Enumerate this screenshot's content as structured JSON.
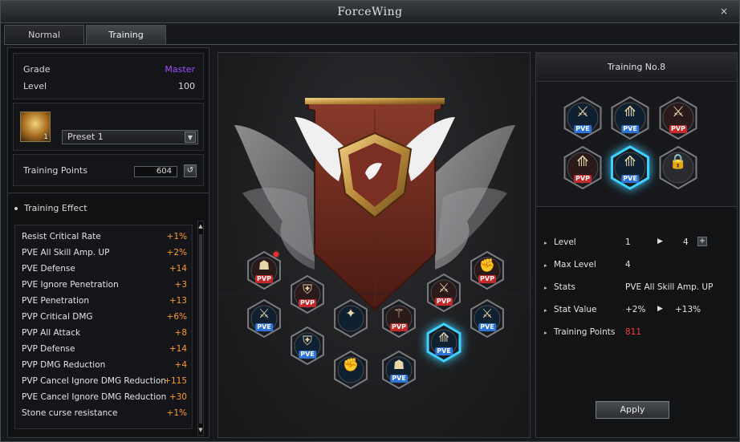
{
  "window": {
    "title": "ForceWing",
    "close_label": "×"
  },
  "tabs": [
    {
      "label": "Normal"
    },
    {
      "label": "Training"
    }
  ],
  "left": {
    "grade": {
      "label": "Grade",
      "value": "Master"
    },
    "level": {
      "label": "Level",
      "value": "100"
    },
    "portrait_num": "1",
    "preset": {
      "selected": "Preset 1"
    },
    "training_points": {
      "label": "Training Points",
      "value": "604"
    },
    "effect_header": "Training Effect",
    "effects": [
      {
        "name": "Resist Critical Rate",
        "value": "+1%"
      },
      {
        "name": "PVE All Skill Amp. UP",
        "value": "+2%"
      },
      {
        "name": "PVE Defense",
        "value": "+14"
      },
      {
        "name": "PVE Ignore Penetration",
        "value": "+3"
      },
      {
        "name": "PVE Penetration",
        "value": "+13"
      },
      {
        "name": "PVP Critical DMG",
        "value": "+6%"
      },
      {
        "name": "PVP All Attack",
        "value": "+8"
      },
      {
        "name": "PVP Defense",
        "value": "+14"
      },
      {
        "name": "PVP DMG Reduction",
        "value": "+4"
      },
      {
        "name": "PVP Cancel Ignore DMG Reduction",
        "value": "+115"
      },
      {
        "name": "PVE Cancel Ignore DMG Reduction",
        "value": "+30"
      },
      {
        "name": "Stone curse resistance",
        "value": "+1%"
      }
    ]
  },
  "tree_nodes": [
    {
      "badge": "PVP",
      "icon": "mage-icon",
      "red_dot": true
    },
    {
      "badge": "PVP",
      "icon": "shield-icon"
    },
    {
      "badge": "PVE",
      "icon": "crossed-swords-icon"
    },
    {
      "badge": "PVE",
      "icon": "shield-icon"
    },
    {
      "badge": "",
      "icon": "warrior-icon"
    },
    {
      "badge": "",
      "icon": "fist-icon"
    },
    {
      "badge": "PVP",
      "icon": "swordsman-icon"
    },
    {
      "badge": "PVE",
      "icon": "mage-icon"
    },
    {
      "badge": "PVP",
      "icon": "crossed-swords-icon"
    },
    {
      "badge": "PVE",
      "icon": "double-blade-icon",
      "selected": true
    },
    {
      "badge": "PVP",
      "icon": "fist-icon"
    },
    {
      "badge": "PVE",
      "icon": "crossed-swords-icon"
    }
  ],
  "training": {
    "title": "Training No.8",
    "nodes": [
      {
        "badge": "PVE",
        "icon": "crossed-swords-icon"
      },
      {
        "badge": "PVE",
        "icon": "double-blade-icon"
      },
      {
        "badge": "PVP",
        "icon": "crossed-swords-icon"
      },
      {
        "badge": "PVP",
        "icon": "double-blade-icon"
      },
      {
        "badge": "PVE",
        "icon": "double-blade-icon",
        "selected": true
      },
      {
        "badge": "",
        "icon": "lock-icon",
        "locked": true
      }
    ],
    "stats": {
      "level": {
        "label": "Level",
        "from": "1",
        "to": "4"
      },
      "max_level": {
        "label": "Max Level",
        "value": "4"
      },
      "stats": {
        "label": "Stats",
        "value": "PVE All Skill Amp. UP"
      },
      "stat_value": {
        "label": "Stat Value",
        "from": "+2%",
        "to": "+13%"
      },
      "training_points": {
        "label": "Training Points",
        "value": "811"
      }
    },
    "apply_label": "Apply"
  },
  "colors": {
    "grade": "#a04cff",
    "effect_value": "#ff9a2e",
    "points_red": "#ff3a3a",
    "pvp": "#c42a2a",
    "pve": "#2d73d8",
    "selected_glow": "#3fd0ff"
  }
}
